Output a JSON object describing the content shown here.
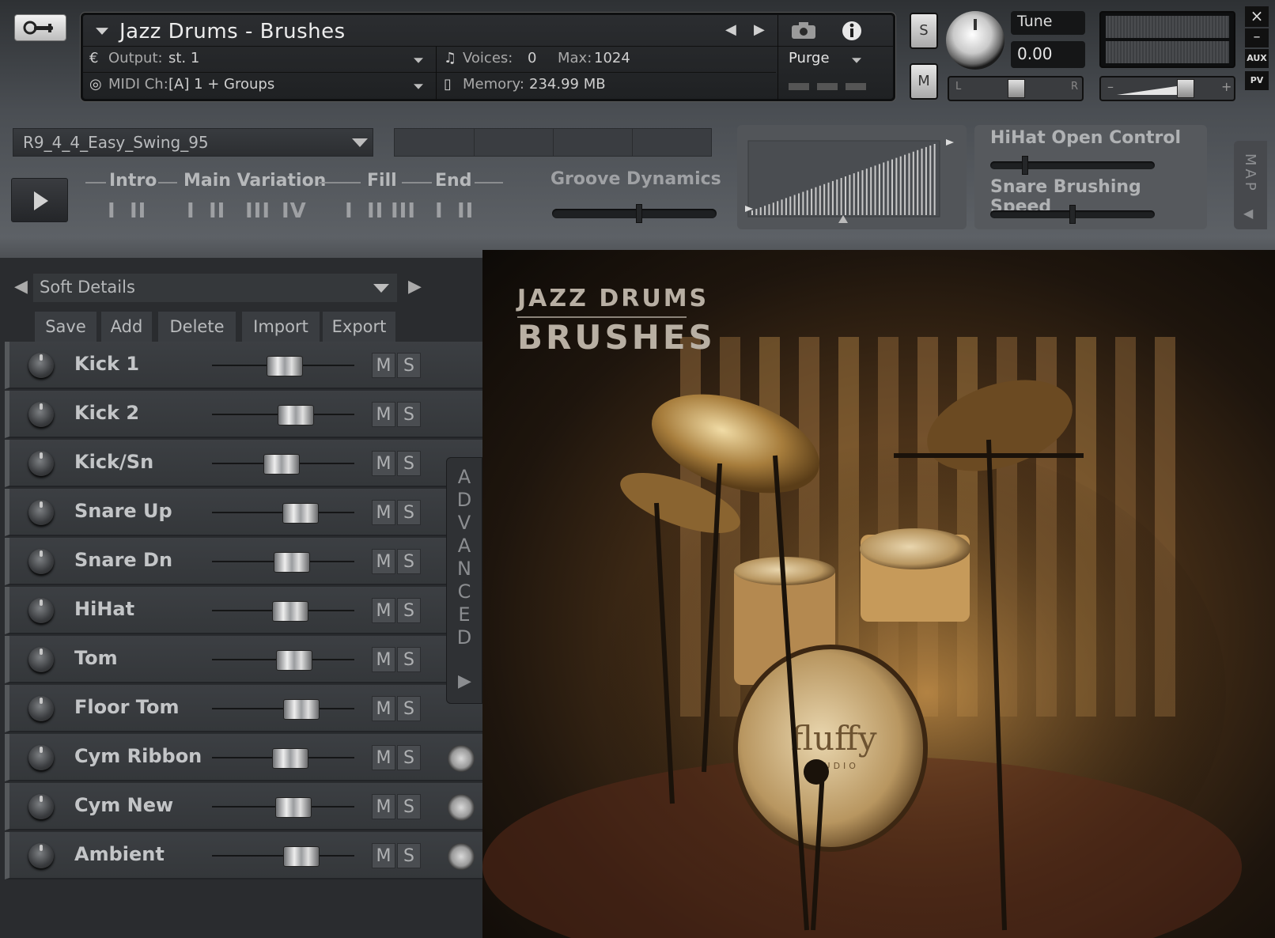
{
  "header": {
    "instrument_title": "Jazz Drums - Brushes",
    "output_label": "Output:",
    "output_value": "st. 1",
    "voices_label": "Voices:",
    "voices_value": "0",
    "max_label": "Max:",
    "max_value": "1024",
    "midi_label": "MIDI Ch:",
    "midi_value": "[A]  1 + Groups",
    "memory_label": "Memory:",
    "memory_value": "234.99 MB",
    "purge_label": "Purge",
    "solo_label": "S",
    "mute_label": "M",
    "tune_label": "Tune",
    "tune_value": "0.00",
    "pan_left": "L",
    "pan_right": "R",
    "vol_minus": "–",
    "vol_plus": "+",
    "aux_label": "AUX",
    "pv_label": "PV",
    "close_glyph": "×",
    "minimize_glyph": "–"
  },
  "groove": {
    "pattern_name": "R9_4_4_Easy_Swing_95",
    "sections": [
      "Intro",
      "Main Variation",
      "Fill",
      "End"
    ],
    "intro_variations": [
      "I",
      "II"
    ],
    "main_variations": [
      "I",
      "II",
      "III",
      "IV"
    ],
    "fill_variations": [
      "I",
      "II",
      "III"
    ],
    "end_variations": [
      "I",
      "II"
    ],
    "dynamics_label": "Groove Dynamics",
    "dynamics_value": 0.53
  },
  "controls": {
    "hihat_open_label": "HiHat Open Control",
    "hihat_open_value": 0.2,
    "snare_brush_label": "Snare Brushing Speed",
    "snare_brush_value": 0.5,
    "map_label": "MAP"
  },
  "mixer": {
    "preset_name": "Soft Details",
    "buttons": [
      "Save",
      "Add",
      "Delete",
      "Import",
      "Export"
    ],
    "mute_label": "M",
    "solo_label": "S",
    "advanced_letters": [
      "A",
      "D",
      "V",
      "A",
      "N",
      "C",
      "E",
      "D"
    ],
    "channels": [
      {
        "name": "Kick 1",
        "level": 0.51
      },
      {
        "name": "Kick 2",
        "level": 0.59
      },
      {
        "name": "Kick/Sn",
        "level": 0.49
      },
      {
        "name": "Snare Up",
        "level": 0.62
      },
      {
        "name": "Snare Dn",
        "level": 0.56
      },
      {
        "name": "HiHat",
        "level": 0.55
      },
      {
        "name": "Tom",
        "level": 0.58
      },
      {
        "name": "Floor Tom",
        "level": 0.63
      },
      {
        "name": "Cym Ribbon",
        "level": 0.55
      },
      {
        "name": "Cym New",
        "level": 0.57
      },
      {
        "name": "Ambient",
        "level": 0.63
      }
    ]
  },
  "artwork": {
    "brand_line1": "JAZZ DRUMS",
    "brand_line2": "BRUSHES",
    "bass_drum_logo": "fluffy",
    "bass_drum_sub": "AUDIO"
  }
}
